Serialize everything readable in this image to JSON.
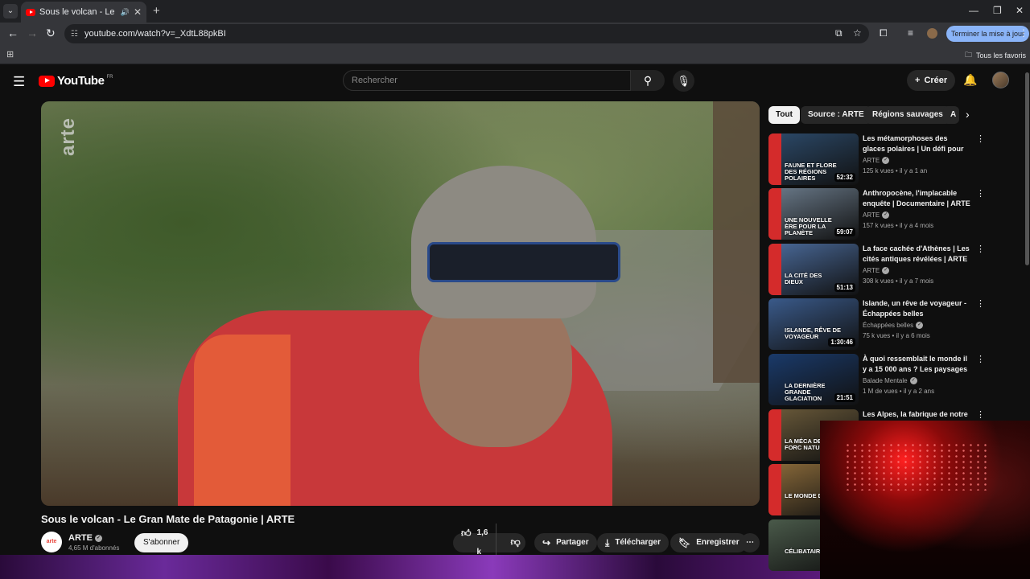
{
  "browser": {
    "tab_title": "Sous le volcan - Le Gran Mate de Patagonie | ARTE",
    "tab_title_short": "Sous le volcan - Le Gran Ma",
    "url": "youtube.com/watch?v=_XdtL88pkBI",
    "update_button": "Terminer la mise à jour",
    "all_bookmarks": "Tous les favoris"
  },
  "youtube": {
    "logo_text": "YouTube",
    "region": "FR",
    "search_placeholder": "Rechercher",
    "create_label": "Créer"
  },
  "video": {
    "title": "Sous le volcan - Le Gran Mate de Patagonie | ARTE",
    "watermark": "arte",
    "channel": "ARTE",
    "channel_avatar_text": "arte",
    "subscribers": "4,65 M d'abonnés",
    "subscribe_label": "S'abonner",
    "likes": "1,6 k",
    "share_label": "Partager",
    "download_label": "Télécharger",
    "save_label": "Enregistrer"
  },
  "chips": [
    "Tout",
    "Source : ARTE",
    "Régions sauvages",
    "A"
  ],
  "recommendations": [
    {
      "title": "Les métamorphoses des glaces polaires | Un défi pour les ...",
      "channel": "ARTE",
      "meta": "125 k vues • il y a 1 an",
      "duration": "52:32",
      "thumb_text": "FAUNE ET FLORE DES RÉGIONS POLAIRES",
      "thumb_color": "#2c4a6a"
    },
    {
      "title": "Anthropocène, l'implacable enquête | Documentaire | ARTE",
      "channel": "ARTE",
      "meta": "157 k vues • il y a 4 mois",
      "duration": "59:07",
      "thumb_text": "UNE NOUVELLE ÈRE POUR LA PLANÈTE",
      "thumb_color": "#6a7a8a"
    },
    {
      "title": "La face cachée d'Athènes | Les cités antiques révélées | ARTE",
      "channel": "ARTE",
      "meta": "308 k vues • il y a 7 mois",
      "duration": "51:13",
      "thumb_text": "LA CITÉ DES DIEUX",
      "thumb_color": "#4a6a9a"
    },
    {
      "title": "Islande, un rêve de voyageur - Échappées belles",
      "channel": "Échappées belles",
      "meta": "75 k vues • il y a 6 mois",
      "duration": "1:30:46",
      "thumb_text": "ISLANDE, RÊVE DE VOYAGEUR",
      "thumb_color": "#3a5a8a"
    },
    {
      "title": "À quoi ressemblait le monde il y a 15 000 ans ? Les paysages ...",
      "channel": "Balade Mentale",
      "meta": "1 M de vues • il y a 2 ans",
      "duration": "21:51",
      "thumb_text": "LA DERNIÈRE GRANDE GLACIATION",
      "thumb_color": "#1a3a6a"
    },
    {
      "title": "Les Alpes, la fabrique de notre",
      "channel": "",
      "meta": "",
      "duration": "",
      "thumb_text": "LA MÉCA DES FORC NATUREL",
      "thumb_color": "#6a5a3a"
    },
    {
      "title": "",
      "channel": "",
      "meta": "",
      "duration": "",
      "thumb_text": "LE MONDE DU RAT",
      "thumb_color": "#8a6a3a"
    },
    {
      "title": "",
      "channel": "",
      "meta": "",
      "duration": "",
      "thumb_text": "CÉLIBATAIR",
      "thumb_color": "#4a5a4a"
    }
  ],
  "colors": {
    "brand_red": "#ff0000",
    "arte_red": "#d42b2b",
    "background": "#0f0f0f"
  }
}
